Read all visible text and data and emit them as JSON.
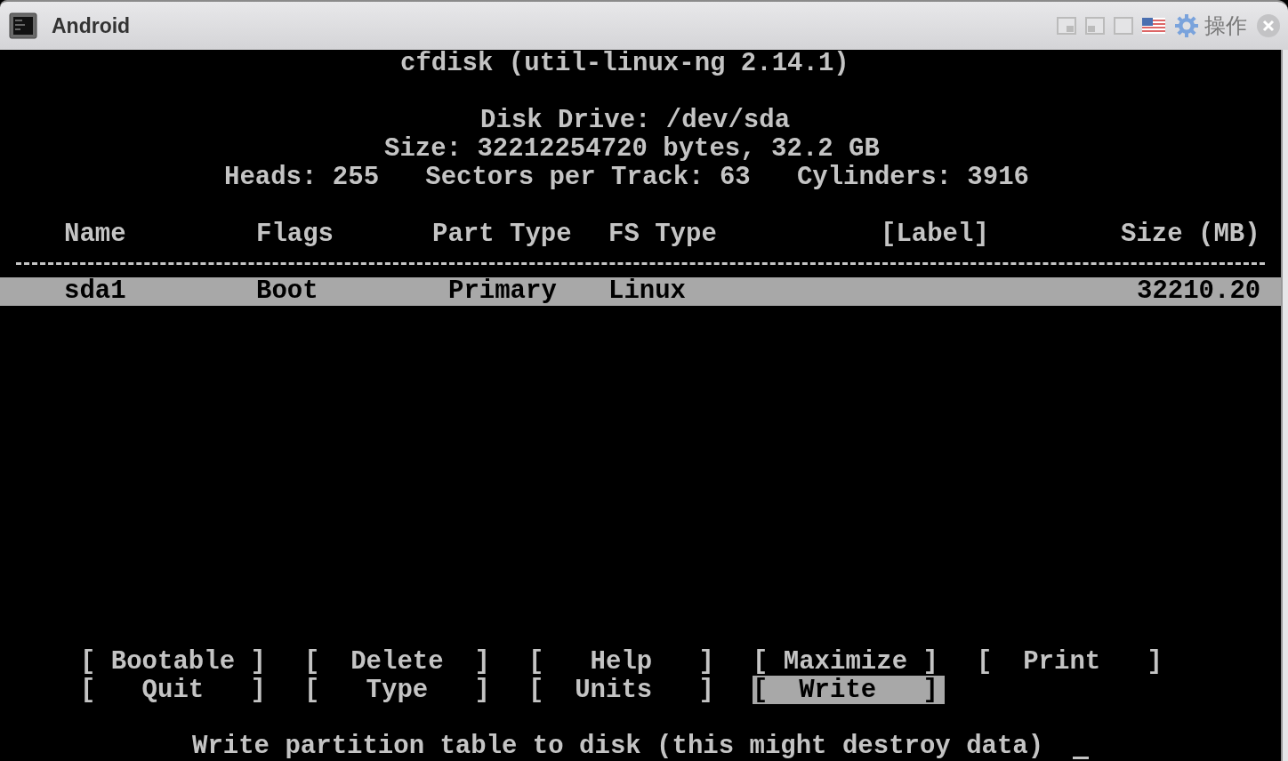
{
  "window": {
    "title": "Android",
    "menu_label": "操作"
  },
  "terminal": {
    "title_line": "cfdisk (util-linux-ng 2.14.1)",
    "disk_drive": "Disk Drive: /dev/sda",
    "size_line": "Size: 32212254720 bytes, 32.2 GB",
    "geometry_line": "Heads: 255   Sectors per Track: 63   Cylinders: 3916",
    "table": {
      "columns": [
        "Name",
        "Flags",
        "Part Type",
        "FS Type",
        "[Label]",
        "Size (MB)"
      ],
      "rows": [
        {
          "name": "sda1",
          "flags": "Boot",
          "part_type": "Primary",
          "fs_type": "Linux",
          "size": "32210.20",
          "selected": true
        }
      ]
    },
    "commands": [
      {
        "label": "[ Bootable ]",
        "selected": false
      },
      {
        "label": "[  Delete  ]",
        "selected": false
      },
      {
        "label": "[   Help   ]",
        "selected": false
      },
      {
        "label": "[ Maximize ]",
        "selected": false
      },
      {
        "label": "[  Print   ]",
        "selected": false
      },
      {
        "label": "[   Quit   ]",
        "selected": false
      },
      {
        "label": "[   Type   ]",
        "selected": false
      },
      {
        "label": "[  Units   ]",
        "selected": false
      },
      {
        "label": "[  Write   ]",
        "selected": true
      }
    ],
    "status_message": "Write partition table to disk (this might destroy data)",
    "cursor_visible": true
  }
}
